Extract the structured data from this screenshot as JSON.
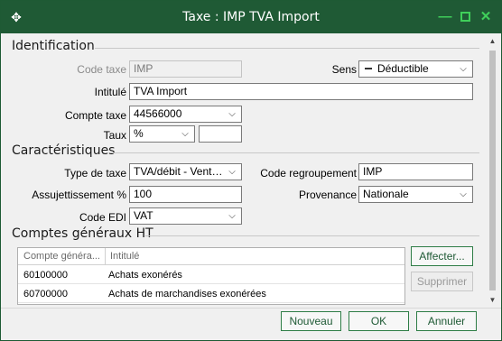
{
  "window": {
    "title": "Taxe : IMP TVA Import"
  },
  "sections": {
    "identification": "Identification",
    "caracteristiques": "Caractéristiques",
    "comptes": "Comptes généraux HT"
  },
  "identification": {
    "code_taxe_label": "Code taxe",
    "code_taxe_value": "IMP",
    "sens_label": "Sens",
    "sens_value": "Déductible",
    "intitule_label": "Intitulé",
    "intitule_value": "TVA Import",
    "compte_taxe_label": "Compte taxe",
    "compte_taxe_value": "44566000",
    "taux_label": "Taux",
    "taux_type_value": "%",
    "taux_value": ""
  },
  "caracteristiques": {
    "type_taxe_label": "Type de taxe",
    "type_taxe_value": "TVA/débit - Vente d...",
    "code_regroupement_label": "Code regroupement",
    "code_regroupement_value": "IMP",
    "assujettissement_label": "Assujettissement %",
    "assujettissement_value": "100",
    "provenance_label": "Provenance",
    "provenance_value": "Nationale",
    "code_edi_label": "Code EDI",
    "code_edi_value": "VAT"
  },
  "comptes": {
    "columns": [
      "Compte généra...",
      "Intitulé"
    ],
    "rows": [
      {
        "compte": "60100000",
        "intitule": "Achats exonérés"
      },
      {
        "compte": "60700000",
        "intitule": "Achats de marchandises exonérées"
      }
    ],
    "affecter_label": "Affecter...",
    "supprimer_label": "Supprimer"
  },
  "footer": {
    "nouveau_label": "Nouveau",
    "ok_label": "OK",
    "annuler_label": "Annuler"
  },
  "colors": {
    "titlebar": "#1f5a35",
    "window_controls": "#3fcf5a",
    "button_border": "#2e7d46"
  },
  "icons": {
    "grip": "move-grip-icon",
    "minimize": "minimize-icon",
    "maximize": "maximize-icon",
    "close": "close-icon",
    "dropdown": "chevron-down-icon",
    "sens": "minus-icon"
  }
}
